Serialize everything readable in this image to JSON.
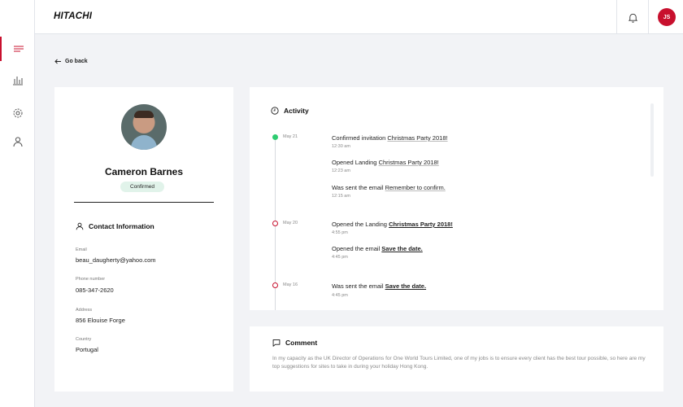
{
  "header": {
    "logo": "HITACHI",
    "user_initials": "JS"
  },
  "nav": {
    "go_back": "Go back"
  },
  "profile": {
    "name": "Cameron Barnes",
    "status": "Confirmed",
    "contact_title": "Contact Information",
    "fields": [
      {
        "label": "Email",
        "value": "beau_daugherty@yahoo.com"
      },
      {
        "label": "Phone number",
        "value": "085-347-2620"
      },
      {
        "label": "Address",
        "value": "856 Elouise Forge"
      },
      {
        "label": "Country",
        "value": "Portugal"
      }
    ]
  },
  "activity": {
    "title": "Activity",
    "groups": [
      {
        "date": "May 21",
        "events": [
          {
            "prefix": "Confirmed invitation ",
            "link": "Christmas Party 2018!",
            "time": "12:30 am"
          },
          {
            "prefix": "Opened Landing ",
            "link": "Christmas Party 2018!",
            "time": "12:23 am"
          },
          {
            "prefix": "Was sent the email ",
            "link": "Remember to confirm.",
            "time": "12:15 am"
          }
        ]
      },
      {
        "date": "May 20",
        "events": [
          {
            "prefix": "Opened the Landing ",
            "link": "Christmas Party 2018!",
            "time": "4:55 pm"
          },
          {
            "prefix": "Opened the email ",
            "link": "Save the date.",
            "time": "4:45 pm"
          }
        ]
      },
      {
        "date": "May 16",
        "events": [
          {
            "prefix": "Was sent the email ",
            "link": "Save the date.",
            "time": "4:45 pm"
          }
        ]
      }
    ]
  },
  "comment": {
    "title": "Comment",
    "text": "In my capacity as the UK Director of Operations for One World Tours Limited, one of my jobs is to ensure every client has the best tour possible, so here are my top suggestions for sites to take in during your holiday Hong Kong."
  },
  "colors": {
    "brand": "#c8102e",
    "confirmed_bg": "#e1f3ea",
    "timeline_active": "#2ecc71"
  }
}
